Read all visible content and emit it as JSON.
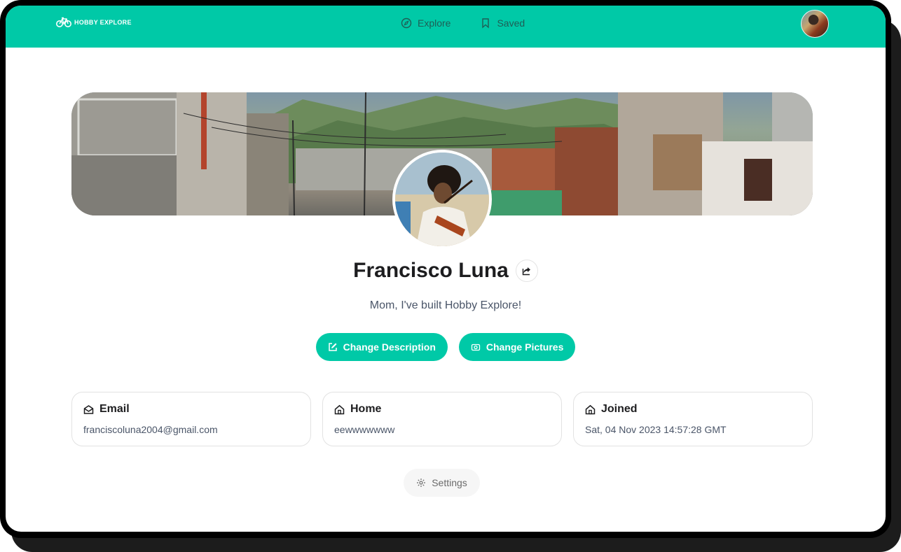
{
  "nav": {
    "logo_text": "HOBBY EXPLORE",
    "links": [
      {
        "label": "Explore",
        "icon": "compass-icon"
      },
      {
        "label": "Saved",
        "icon": "bookmark-icon"
      }
    ],
    "avatar_icon": "user-avatar"
  },
  "profile": {
    "name": "Francisco Luna",
    "description": "Mom, I've built Hobby Explore!"
  },
  "actions": {
    "change_description": "Change Description",
    "change_pictures": "Change Pictures"
  },
  "cards": [
    {
      "title": "Email",
      "icon": "envelope-icon",
      "value": "franciscoluna2004@gmail.com"
    },
    {
      "title": "Home",
      "icon": "home-icon",
      "value": "eewwwwwww"
    },
    {
      "title": "Joined",
      "icon": "home-icon",
      "value": "Sat, 04 Nov 2023 14:57:28 GMT"
    }
  ],
  "settings_label": "Settings",
  "colors": {
    "accent": "#00c9a7",
    "text": "#1d1d1f",
    "muted": "#4a5568"
  }
}
